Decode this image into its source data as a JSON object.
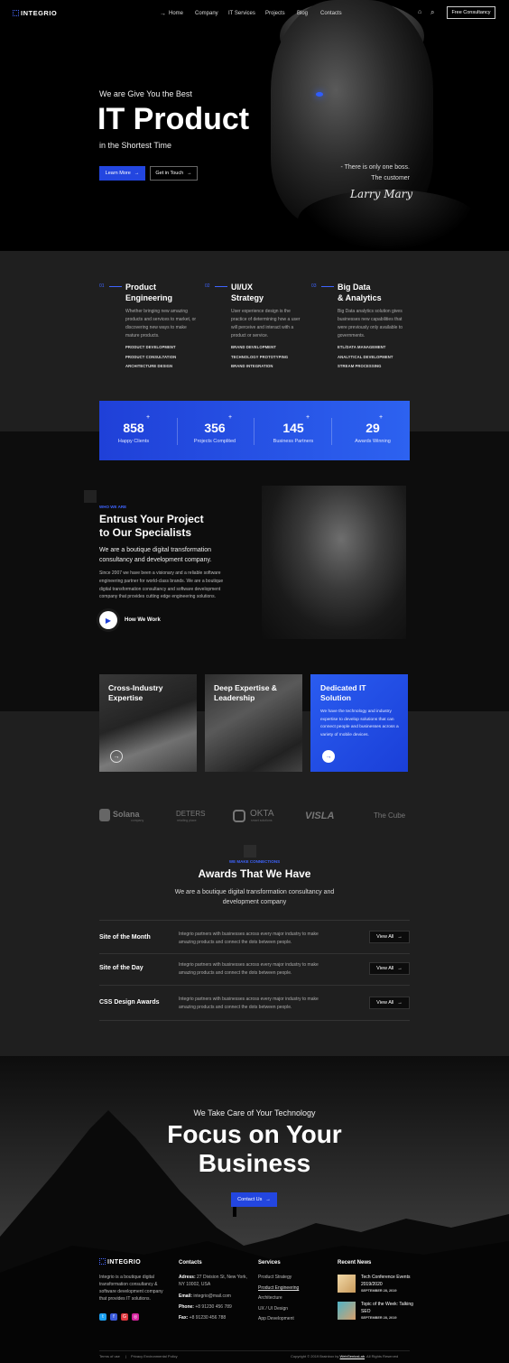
{
  "header": {
    "logo": "INTEGRIO",
    "nav": [
      "Home",
      "Company",
      "IT Services",
      "Projects",
      "Blog",
      "Contacts"
    ],
    "cta": "Free Consultancy",
    "icons": [
      "bag-icon",
      "search-icon",
      "arrow-right-icon"
    ]
  },
  "hero": {
    "kicker": "We are Give You the Best",
    "title": "IT Product",
    "subtitle": "in the Shortest Time",
    "btn_primary": "Learn More",
    "btn_secondary": "Get in Touch",
    "quote_line1": "- There is only one boss.",
    "quote_line2": "The customer",
    "signature": "Larry Mary"
  },
  "services": [
    {
      "num": "01",
      "title1": "Product",
      "title2": "Engineering",
      "desc": "Whether bringing new amazing products and services to market, or discovering new ways to make mature products.",
      "items": [
        "PRODUCT DEVELOPMENT",
        "PRODUCT CONSULTATION",
        "ARCHITECTURE DESIGN"
      ]
    },
    {
      "num": "02",
      "title1": "UI/UX",
      "title2": "Strategy",
      "desc": "User experience design is the practice of determining how a user will perceive and interact with a product or service.",
      "items": [
        "BRAND DEVELOPMENT",
        "TECHNOLOGY PROTOTYPING",
        "BRAND INTEGRATION"
      ]
    },
    {
      "num": "03",
      "title1": "Big Data",
      "title2": "& Analytics",
      "desc": "Big Data analytics solution gives businesses new capabilities that were previously only available to governments.",
      "items": [
        "ETL/DATA MANAGEMENT",
        "ANALYTICAL DEVELOPMENT",
        "STREAM PROCESSING"
      ]
    }
  ],
  "stats": [
    {
      "value": "858",
      "label": "Happy Clients"
    },
    {
      "value": "356",
      "label": "Projects Complited"
    },
    {
      "value": "145",
      "label": "Business Partners"
    },
    {
      "value": "29",
      "label": "Awards Winning"
    }
  ],
  "stat_plus": "+",
  "about": {
    "kicker": "WHO WE ARE",
    "title1": "Entrust Your Project",
    "title2": "to Our Specialists",
    "lead": "We are a boutique digital transformation consultancy and development company.",
    "body": "Since 2007 we have been a visionary and a reliable software engineering partner for world-class brands. We are a boutique digital transformation consultancy and software development company that provides cutting edge engineering solutions.",
    "video_label": "How We Work"
  },
  "cards": [
    {
      "title1": "Cross-Industry",
      "title2": "Expertise"
    },
    {
      "title1": "Deep Expertise &",
      "title2": "Leadership"
    },
    {
      "title1": "Dedicated IT",
      "title2": "Solution",
      "desc": "We have the technology and industry expertise to develop solutions that can connect people and businesses across a variety of mobile devices."
    }
  ],
  "logos": [
    "Solana",
    "company",
    "DETERS",
    "retailing place",
    "OKTA",
    "smart solutions",
    "VISLA",
    "The Cube"
  ],
  "awards": {
    "kicker": "WE MAKE CONNECTIONS",
    "title": "Awards That We Have",
    "lead": "We are a boutique digital transformation consultancy and development company",
    "view_all": "View All",
    "rows": [
      {
        "name": "Site of the Month",
        "desc": "Integrio partners with businesses across every major industry to make amazing products and connect the dots between people."
      },
      {
        "name": "Site of the Day",
        "desc": "Integrio partners with businesses across every major industry to make amazing products and connect the dots between people."
      },
      {
        "name": "CSS Design Awards",
        "desc": "Integrio partners with businesses across every major industry to make amazing products and connect the dots between people."
      }
    ]
  },
  "cta": {
    "kicker": "We Take Care of Your Technology",
    "title1": "Focus on Your",
    "title2": "Business",
    "button": "Contact Us"
  },
  "footer": {
    "logo": "INTEGRIO",
    "about": "Integrio is a boutique digital transformation consultancy & software development company that provides IT solutions.",
    "contacts_h": "Contacts",
    "address_lbl": "Adress:",
    "address": "27 Division St, New York, NY 10002, USA",
    "email_lbl": "Email:",
    "email": "integrio@mail.com",
    "phone_lbl": "Phone:",
    "phone": "+8 91230 456 789",
    "fax_lbl": "Fax:",
    "fax": "+8 91230 456 788",
    "services_h": "Services",
    "services": [
      "Product Strategy",
      "Product Engineering",
      "Architecture",
      "UX / UI Design",
      "App Development"
    ],
    "news_h": "Recent News",
    "news": [
      {
        "title": "Tech Conference Events 2019/2020",
        "date": "SEPTEMBER 28, 2019"
      },
      {
        "title": "Topic of the Week: Talking SEO",
        "date": "SEPTEMBER 28, 2019"
      }
    ],
    "bottom_left": "Terms of use",
    "bottom_mid": "Privacy Environmental Policy",
    "copyright_pre": "Copyright © 2019 Brainbox by",
    "copyright_link": "WebGeniusLab",
    "copyright_post": ". All Rights Reserved",
    "social": [
      "t",
      "f",
      "G",
      "◎"
    ]
  },
  "colors": {
    "accent": "#2346e0",
    "accent_light": "#3e64ff",
    "bg_dark": "#000000",
    "bg_section": "#1f1f1f"
  }
}
